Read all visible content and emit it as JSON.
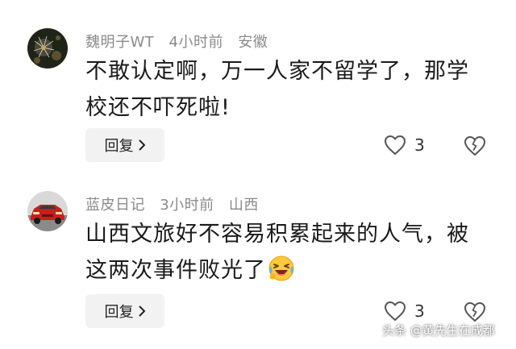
{
  "comments": [
    {
      "username": "魏明子WT",
      "time": "4小时前",
      "location": "安徽",
      "text": "不敢认定啊，万一人家不留学了，那学校还不吓死啦!",
      "reply_label": "回复",
      "likes": "3",
      "avatar_icon": "dandelion-photo-avatar"
    },
    {
      "username": "蓝皮日记",
      "time": "3小时前",
      "location": "山西",
      "text": "山西文旅好不容易积累起来的人气，被这两次事件败光了",
      "emoji": "laughing-crying-emoji",
      "reply_label": "回复",
      "likes": "3",
      "avatar_icon": "red-sports-car-avatar"
    }
  ],
  "watermark": "头条 @黄先生在成都",
  "colors": {
    "meta_text": "#8a8a8a",
    "body_text": "#1a1a1a",
    "reply_bg": "#f2f2f2",
    "icon_stroke": "#555555"
  }
}
